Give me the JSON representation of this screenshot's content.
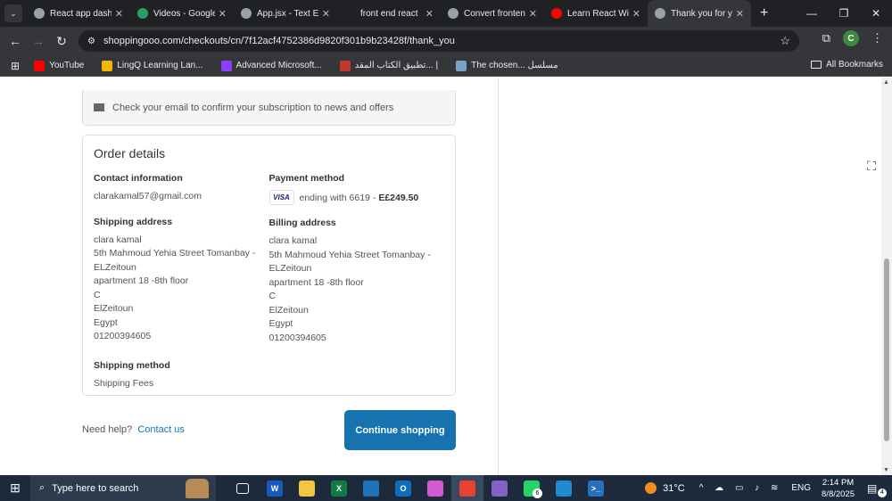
{
  "browser": {
    "tabs": [
      {
        "title": "React app dashb",
        "icon": "globe-icon",
        "color": "#9aa0a6"
      },
      {
        "title": "Videos - Google",
        "icon": "google-drive-icon",
        "color": "#1fa463"
      },
      {
        "title": "App.jsx - Text Ed",
        "icon": "file-icon",
        "color": "#9aa0a6"
      },
      {
        "title": "front end react",
        "icon": "chatgpt-icon",
        "color": "#202124"
      },
      {
        "title": "Convert frontend p",
        "icon": "globe-icon",
        "color": "#9aa0a6"
      },
      {
        "title": "Learn React With",
        "icon": "youtube-icon",
        "color": "#ff0000"
      },
      {
        "title": "Thank you for yo",
        "icon": "globe-icon",
        "color": "#9aa0a6"
      }
    ],
    "url": "shoppingooo.com/checkouts/cn/7f12acf4752386d9820f301b9b23428f/thank_you",
    "bookmarks": [
      {
        "label": "YouTube",
        "color": "#ff0000"
      },
      {
        "label": "LingQ Learning Lan...",
        "color": "#f2b705"
      },
      {
        "label": "Advanced Microsoft...",
        "color": "#8a3ffc"
      },
      {
        "label": "تطبيق الكتاب المقد... |",
        "color": "#c0392b"
      },
      {
        "label": "The chosen... مسلسل",
        "color": "#7aa3c7"
      }
    ],
    "all_bookmarks": "All Bookmarks",
    "profile_initial": "C"
  },
  "page": {
    "newsletter_text": "Check your email to confirm your subscription to news and offers",
    "order_details_title": "Order details",
    "contact": {
      "label": "Contact information",
      "email": "clarakamal57@gmail.com"
    },
    "payment": {
      "label": "Payment method",
      "card_brand": "VISA",
      "ending": "ending with 6619 -",
      "amount": "E£249.50"
    },
    "shipping_address": {
      "label": "Shipping address",
      "lines": [
        "clara kamal",
        "5th Mahmoud Yehia Street Tomanbay -",
        "ELZeitoun",
        "apartment 18 -8th floor",
        "C",
        "ElZeitoun",
        "Egypt",
        "01200394605"
      ]
    },
    "billing_address": {
      "label": "Billing address",
      "lines": [
        "clara kamal",
        "5th Mahmoud Yehia Street Tomanbay -",
        "ELZeitoun",
        "apartment 18 -8th floor",
        "C",
        "ElZeitoun",
        "Egypt",
        "01200394605"
      ]
    },
    "shipping_method": {
      "label": "Shipping method",
      "value": "Shipping Fees"
    },
    "help_text": "Need help?",
    "contact_link": "Contact us",
    "continue_button": "Continue shopping"
  },
  "taskbar": {
    "search_placeholder": "Type here to search",
    "apps": [
      {
        "name": "task-view",
        "label": "",
        "color": "#1c2a3c"
      },
      {
        "name": "word",
        "label": "W",
        "color": "#185abd"
      },
      {
        "name": "file-explorer",
        "label": "",
        "color": "#f4c542"
      },
      {
        "name": "excel",
        "label": "X",
        "color": "#107c41"
      },
      {
        "name": "onedrive",
        "label": "",
        "color": "#1e73be"
      },
      {
        "name": "outlook",
        "label": "O",
        "color": "#0f6cbd"
      },
      {
        "name": "copilot",
        "label": "",
        "color": "#d45ad1"
      },
      {
        "name": "chrome",
        "label": "",
        "color": "#e94235"
      },
      {
        "name": "visual-studio",
        "label": "",
        "color": "#8661c5"
      },
      {
        "name": "whatsapp",
        "label": "",
        "color": "#25d366",
        "badge": "6"
      },
      {
        "name": "vscode",
        "label": "",
        "color": "#1f8ad2"
      },
      {
        "name": "powershell",
        "label": ">_",
        "color": "#2671be"
      }
    ],
    "weather": "31°C",
    "language": "ENG",
    "time": "2:14 PM",
    "date": "8/8/2025",
    "notification_count": "4"
  }
}
